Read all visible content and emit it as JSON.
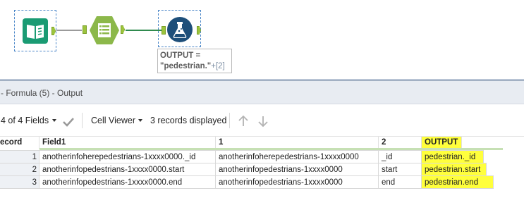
{
  "canvas": {
    "annotation": {
      "line1": "OUTPUT =",
      "line2": "\"pedestrian.\"",
      "line2_suffix": "+[2]"
    },
    "colors": {
      "connection": "#9b9b9b",
      "connection_active": "#2f8a4e",
      "anchor": "#9cc43c",
      "book_tool": "#1a9b73",
      "select_tool": "#8cb84a",
      "formula_tool": "#1e4f7a",
      "selection_border": "#4a86c8"
    },
    "tools": [
      {
        "name": "Input Data",
        "icon": "book-icon"
      },
      {
        "name": "Select",
        "icon": "select-list-icon"
      },
      {
        "name": "Formula",
        "icon": "flask-icon"
      }
    ]
  },
  "results": {
    "title": "- Formula (5) - Output",
    "toolbar": {
      "fields": "4 of 4 Fields",
      "viewer": "Cell Viewer",
      "records": "3 records displayed"
    },
    "columns": [
      "ecord",
      "Field1",
      "1",
      "2",
      "OUTPUT"
    ],
    "rows": [
      {
        "record": "1",
        "field1": "anotherinfoherepedestrians-1xxxx0000._id",
        "c1": "anotherinfoherepedestrians-1xxxx0000",
        "c2": "_id",
        "output": "pedestrian._id"
      },
      {
        "record": "2",
        "field1": "anotherinfopedestrians-1xxxx0000.start",
        "c1": "anotherinfopedestrians-1xxxx0000",
        "c2": "start",
        "output": "pedestrian.start"
      },
      {
        "record": "3",
        "field1": "anotherinfopedestrians-1xxxx0000.end",
        "c1": "anotherinfopedestrians-1xxxx0000",
        "c2": "end",
        "output": "pedestrian.end"
      }
    ],
    "highlight_color": "#ffff3c"
  }
}
